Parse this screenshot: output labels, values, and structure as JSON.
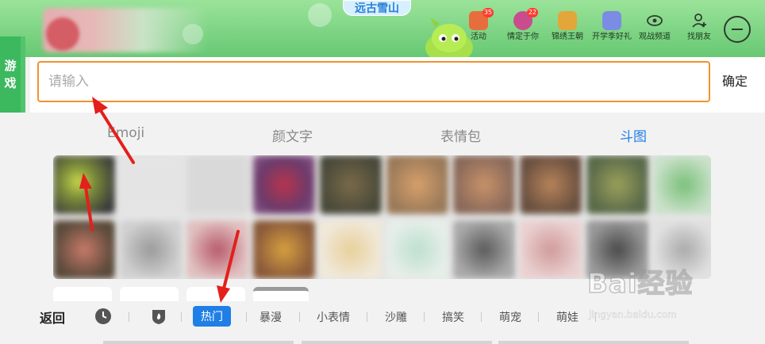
{
  "banner": {
    "title": "远古雪山",
    "icons": [
      {
        "name": "activity",
        "label": "活动",
        "badge": "35",
        "color": "#e86d3c"
      },
      {
        "name": "destined",
        "label": "情定于你",
        "badge": "22",
        "color": "#c94d8e"
      },
      {
        "name": "dynasty",
        "label": "锦绣王朝",
        "badge": "",
        "color": "#e3a63a"
      },
      {
        "name": "school-gift",
        "label": "开学季好礼",
        "badge": "",
        "color": "#7b8ce3"
      },
      {
        "name": "watch-channel",
        "label": "观战频道",
        "badge": "",
        "color": "#2f3d2f"
      },
      {
        "name": "find-friends",
        "label": "找朋友",
        "badge": "",
        "color": "#2f3d2f"
      }
    ]
  },
  "side_tab": {
    "line1": "游",
    "line2": "戏"
  },
  "search": {
    "placeholder": "请输入",
    "value": "",
    "confirm_label": "确定"
  },
  "tabs": [
    {
      "label": "Emoji",
      "active": false
    },
    {
      "label": "颜文字",
      "active": false
    },
    {
      "label": "表情包",
      "active": false
    },
    {
      "label": "斗图",
      "active": true
    }
  ],
  "bottom_bar": {
    "back_label": "返回",
    "categories": [
      {
        "label": "热门",
        "active": true
      },
      {
        "label": "暴漫",
        "active": false
      },
      {
        "label": "小表情",
        "active": false
      },
      {
        "label": "沙雕",
        "active": false
      },
      {
        "label": "搞笑",
        "active": false
      },
      {
        "label": "萌宠",
        "active": false
      },
      {
        "label": "萌娃",
        "active": false
      }
    ]
  },
  "watermark": {
    "brand": "Bai经验",
    "url": "jingyan.baidu.com"
  },
  "colors": {
    "accent": "#1f7fe6",
    "input_border": "#f0932f",
    "side_tab": "#3cb85f",
    "annotation": "#e3201b"
  }
}
